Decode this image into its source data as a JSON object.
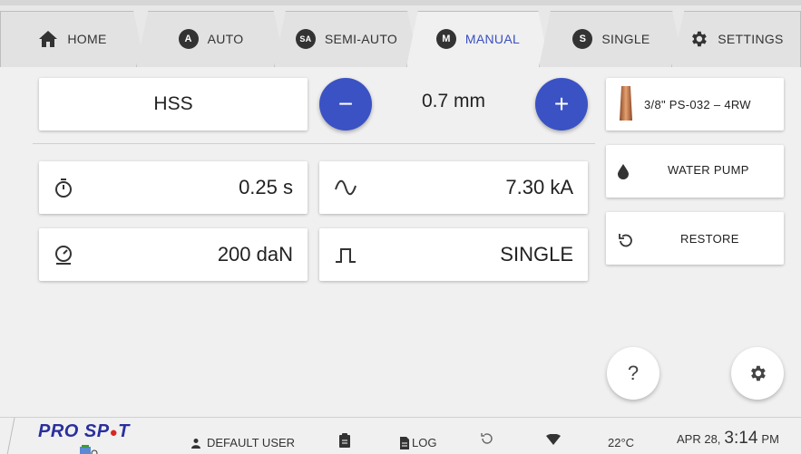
{
  "tabs": [
    {
      "label": "HOME",
      "icon": "home-icon"
    },
    {
      "label": "AUTO",
      "badge": "A"
    },
    {
      "label": "SEMI-AUTO",
      "badge": "SA"
    },
    {
      "label": "MANUAL",
      "badge": "M"
    },
    {
      "label": "SINGLE",
      "badge": "S"
    },
    {
      "label": "SETTINGS",
      "icon": "gear-icon"
    }
  ],
  "active_tab": "MANUAL",
  "main": {
    "material": "HSS",
    "thickness": "0.7 mm",
    "minus": "−",
    "plus": "+",
    "time": "0.25 s",
    "current": "7.30 kA",
    "force": "200 daN",
    "pulse": "SINGLE"
  },
  "side": {
    "electrode": "3/8\" PS-032 – 4RW",
    "water_pump": "WATER PUMP",
    "restore": "RESTORE"
  },
  "fabs": {
    "help": "?"
  },
  "footer": {
    "logo_pro": "PRO SP",
    "logo_spot_o": "●",
    "logo_t": "T",
    "user": "DEFAULT USER",
    "log": "LOG",
    "temperature": "22°C",
    "date": "APR 28,",
    "time": "3:14",
    "ampm": "PM"
  },
  "colors": {
    "accent": "#3b52c4",
    "active_tab_text": "#3a4fc0"
  }
}
